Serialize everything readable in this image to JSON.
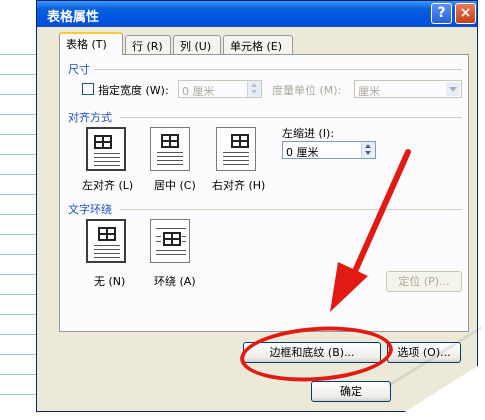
{
  "dialog": {
    "title": "表格属性",
    "help_glyph": "?",
    "close_glyph": "×"
  },
  "tabs": [
    {
      "label": "表格 (T)",
      "active": true
    },
    {
      "label": "行 (R)",
      "active": false
    },
    {
      "label": "列 (U)",
      "active": false
    },
    {
      "label": "单元格 (E)",
      "active": false
    }
  ],
  "size": {
    "group": "尺寸",
    "specify_width_label": "指定宽度 (W):",
    "width_value": "0 厘米",
    "unit_label": "度量单位 (M):",
    "unit_value": "厘米"
  },
  "alignment": {
    "group": "对齐方式",
    "options": [
      "左对齐 (L)",
      "居中 (C)",
      "右对齐 (H)"
    ],
    "selected": "左对齐 (L)",
    "indent_label": "左缩进 (I):",
    "indent_value": "0 厘米"
  },
  "wrapping": {
    "group": "文字环绕",
    "options": [
      "无 (N)",
      "环绕 (A)"
    ],
    "selected": "无 (N)",
    "position_button": "定位 (P)..."
  },
  "buttons": {
    "borders": "边框和底纹 (B)...",
    "options": "选项 (O)...",
    "ok": "确定"
  },
  "colors": {
    "annotation_red": "#e11b14",
    "title_blue": "#0054e3",
    "group_blue": "#1c4fbf"
  }
}
